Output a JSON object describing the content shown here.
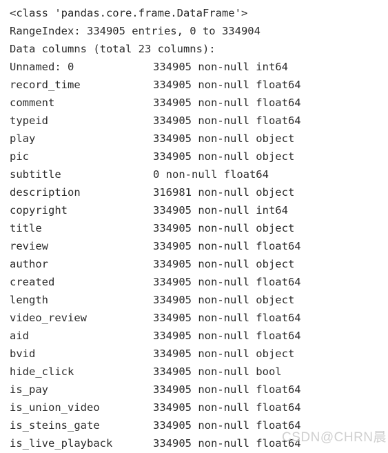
{
  "header": {
    "class_line": "<class 'pandas.core.frame.DataFrame'>",
    "range_index_line": "RangeIndex: 334905 entries, 0 to 334904",
    "data_columns_line": "Data columns (total 23 columns):"
  },
  "columns": [
    {
      "name": "Unnamed: 0",
      "info": "334905 non-null int64"
    },
    {
      "name": "record_time",
      "info": "334905 non-null float64"
    },
    {
      "name": "comment",
      "info": "334905 non-null float64"
    },
    {
      "name": "typeid",
      "info": "334905 non-null float64"
    },
    {
      "name": "play",
      "info": "334905 non-null object"
    },
    {
      "name": "pic",
      "info": "334905 non-null object"
    },
    {
      "name": "subtitle",
      "info": "0 non-null float64"
    },
    {
      "name": "description",
      "info": "316981 non-null object"
    },
    {
      "name": "copyright",
      "info": "334905 non-null int64"
    },
    {
      "name": "title",
      "info": "334905 non-null object"
    },
    {
      "name": "review",
      "info": "334905 non-null float64"
    },
    {
      "name": "author",
      "info": "334905 non-null object"
    },
    {
      "name": "created",
      "info": "334905 non-null float64"
    },
    {
      "name": "length",
      "info": "334905 non-null object"
    },
    {
      "name": "video_review",
      "info": "334905 non-null float64"
    },
    {
      "name": "aid",
      "info": "334905 non-null float64"
    },
    {
      "name": "bvid",
      "info": "334905 non-null object"
    },
    {
      "name": "hide_click",
      "info": "334905 non-null bool"
    },
    {
      "name": "is_pay",
      "info": "334905 non-null float64"
    },
    {
      "name": "is_union_video",
      "info": "334905 non-null float64"
    },
    {
      "name": "is_steins_gate",
      "info": "334905 non-null float64"
    },
    {
      "name": "is_live_playback",
      "info": "334905 non-null float64"
    }
  ],
  "watermark": {
    "text": "CSDN@CHRN晨"
  }
}
